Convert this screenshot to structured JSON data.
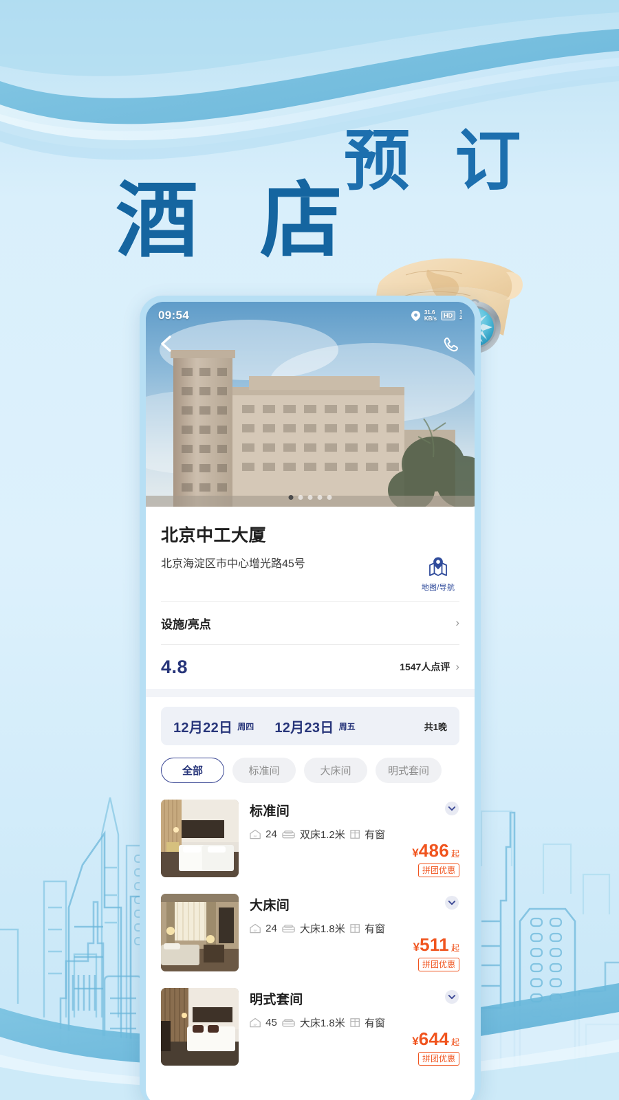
{
  "poster": {
    "headline_main": "酒 店",
    "headline_sub": "预 订",
    "brand_blue": "#1565a0",
    "accent_orange": "#f0541e",
    "accent_navy": "#27357a"
  },
  "statusbar": {
    "time": "09:54",
    "location_icon": "location-pin-icon",
    "net_speed": "31.6",
    "net_unit": "KB/s",
    "hd_label": "HD",
    "sim1": "1",
    "sim2": "2"
  },
  "hero": {
    "back_icon": "chevron-left-icon",
    "call_icon": "phone-handset-icon",
    "dots_total": 5,
    "dots_active": 1
  },
  "hotel": {
    "name": "北京中工大厦",
    "address": "北京海淀区市中心增光路45号",
    "map_nav_label": "地图/导航",
    "map_nav_icon": "map-pin-icon",
    "facilities_label": "设施/亮点",
    "chevron": "›",
    "rating": "4.8",
    "review_count": "1547人点评"
  },
  "dates": {
    "checkin_date": "12月22日",
    "checkin_weekday": "周四",
    "checkout_date": "12月23日",
    "checkout_weekday": "周五",
    "nights": "共1晚"
  },
  "filters": [
    {
      "label": "全部",
      "selected": true
    },
    {
      "label": "标准间",
      "selected": false
    },
    {
      "label": "大床间",
      "selected": false
    },
    {
      "label": "明式套间",
      "selected": false
    }
  ],
  "rooms": [
    {
      "name": "标准间",
      "area_icon": "area-house-icon",
      "area": "24",
      "bed_icon": "bed-icon",
      "bed": "双床1.2米",
      "window_icon": "window-icon",
      "window": "有窗",
      "currency": "¥",
      "price": "486",
      "price_suffix": "起",
      "promo": "拼团优惠",
      "expand_icon": "chevron-down-circle-icon",
      "thumb_tone_a": "#8a7358",
      "thumb_tone_b": "#2b2118"
    },
    {
      "name": "大床间",
      "area_icon": "area-house-icon",
      "area": "24",
      "bed_icon": "bed-icon",
      "bed": "大床1.8米",
      "window_icon": "window-icon",
      "window": "有窗",
      "currency": "¥",
      "price": "511",
      "price_suffix": "起",
      "promo": "拼团优惠",
      "expand_icon": "chevron-down-circle-icon",
      "thumb_tone_a": "#a08a64",
      "thumb_tone_b": "#3a2c1d"
    },
    {
      "name": "明式套间",
      "area_icon": "area-house-icon",
      "area": "45",
      "bed_icon": "bed-icon",
      "bed": "大床1.8米",
      "window_icon": "window-icon",
      "window": "有窗",
      "currency": "¥",
      "price": "644",
      "price_suffix": "起",
      "promo": "拼团优惠",
      "expand_icon": "chevron-down-circle-icon",
      "thumb_tone_a": "#7d6246",
      "thumb_tone_b": "#241a12"
    }
  ]
}
